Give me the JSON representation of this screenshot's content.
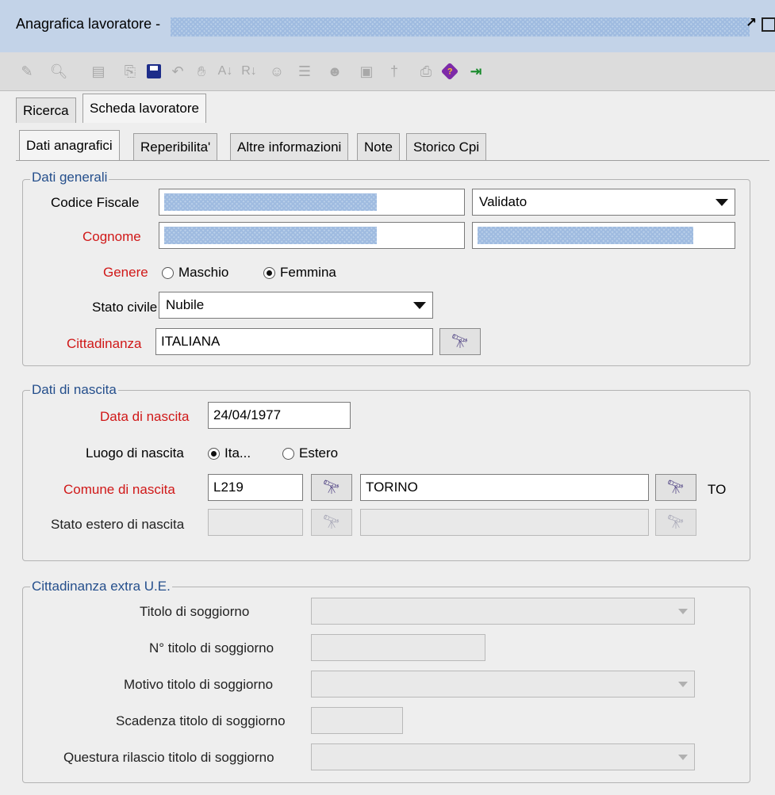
{
  "window": {
    "title": "Anagrafica lavoratore -",
    "restore_icon": "restore-icon",
    "maximize_icon": "maximize-icon"
  },
  "toolbar": {
    "icons": [
      "edit-icon",
      "search-icon",
      "new-document-icon",
      "open-icon",
      "save-icon",
      "undo-icon",
      "stop-icon",
      "sort-ascending-icon",
      "sort-descending-icon",
      "users-icon",
      "list-icon",
      "group-icon",
      "camera-icon",
      "pin-icon",
      "print-icon",
      "help-book-icon",
      "exit-door-icon"
    ]
  },
  "outer_tabs": [
    {
      "label": "Ricerca",
      "selected": false
    },
    {
      "label": "Scheda lavoratore",
      "selected": true
    }
  ],
  "inner_tabs": [
    {
      "label": "Dati anagrafici",
      "selected": true
    },
    {
      "label": "Reperibilita'",
      "selected": false
    },
    {
      "label": "Altre informazioni",
      "selected": false
    },
    {
      "label": "Note",
      "selected": false
    },
    {
      "label": "Storico Cpi",
      "selected": false
    }
  ],
  "dati_generali": {
    "legend": "Dati generali",
    "codice_fiscale_label": "Codice Fiscale",
    "codice_fiscale_status": "Validato",
    "cognome_label": "Cognome",
    "genere_label": "Genere",
    "genere_options": [
      "Maschio",
      "Femmina"
    ],
    "genere_selected": "Femmina",
    "stato_civile_label": "Stato civile",
    "stato_civile_value": "Nubile",
    "cittadinanza_label": "Cittadinanza",
    "cittadinanza_value": "ITALIANA"
  },
  "dati_nascita": {
    "legend": "Dati di nascita",
    "data_label": "Data di nascita",
    "data_value": "24/04/1977",
    "luogo_label": "Luogo di nascita",
    "luogo_options": [
      "Ita...",
      "Estero"
    ],
    "luogo_selected": "Ita...",
    "comune_label": "Comune di nascita",
    "comune_code": "L219",
    "comune_name": "TORINO",
    "provincia": "TO",
    "stato_estero_label": "Stato estero di nascita"
  },
  "extra_ue": {
    "legend": "Cittadinanza extra U.E.",
    "titolo_label": "Titolo di soggiorno",
    "numero_label": "N° titolo di soggiorno",
    "motivo_label": "Motivo titolo di soggiorno",
    "scadenza_label": "Scadenza titolo di soggiorno",
    "questura_label": "Questura rilascio titolo di soggiorno"
  },
  "colors": {
    "required_label": "#d01818",
    "legend": "#254f8c",
    "title_bar": "#c3d3e8",
    "panel_bg": "#eeeeee"
  }
}
